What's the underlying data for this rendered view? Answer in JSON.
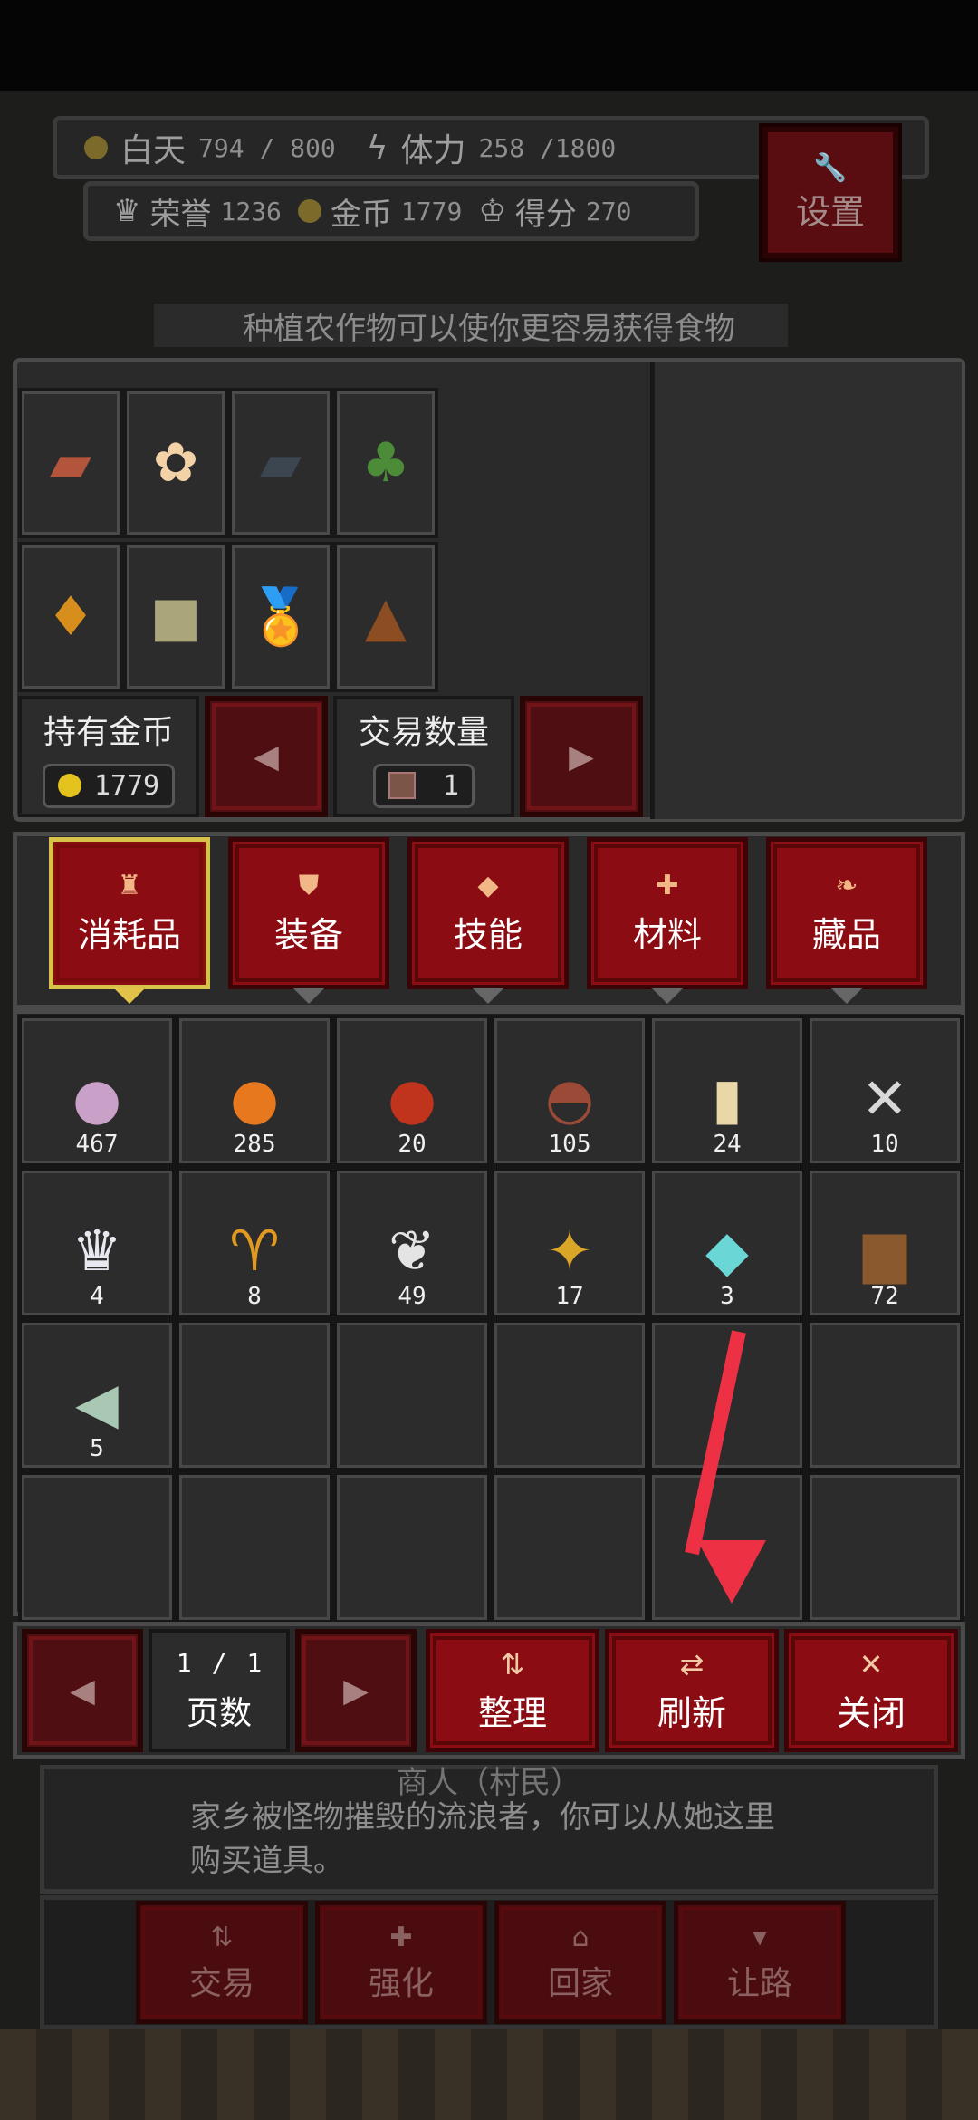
{
  "hud": {
    "day_label": "白天",
    "day_value": "794 / 800",
    "stamina_label": "体力",
    "stamina_value": "258 /1800",
    "honor_label": "荣誉",
    "honor_value": "1236",
    "gold_label": "金币",
    "gold_value": "1779",
    "score_label": "得分",
    "score_value": "270",
    "settings_label": "设置",
    "hint": "种植农作物可以使你更容易获得食物"
  },
  "trade": {
    "items": [
      {
        "icon": "brick-block-icon",
        "glyph": "▰",
        "color": "#b2553c"
      },
      {
        "icon": "flower-icon",
        "glyph": "✿",
        "color": "#f4d2a8"
      },
      {
        "icon": "stone-block-icon",
        "glyph": "▰",
        "color": "#3c4650"
      },
      {
        "icon": "tree-icon",
        "glyph": "♣",
        "color": "#4c8c38"
      },
      {
        "icon": "amber-shard-icon",
        "glyph": "♦",
        "color": "#d88e1c"
      },
      {
        "icon": "sand-block-icon",
        "glyph": "■",
        "color": "#aaa57a"
      },
      {
        "icon": "medal-icon",
        "glyph": "🏅",
        "color": "#e0a428"
      },
      {
        "icon": "dung-icon",
        "glyph": "▲",
        "color": "#8c4d22"
      }
    ],
    "gold_label": "持有金币",
    "gold_value": "1779",
    "qty_label": "交易数量",
    "qty_value": "1"
  },
  "tabs": [
    {
      "label": "消耗品",
      "icon": "potion-icon",
      "glyph": "♜",
      "selected": true
    },
    {
      "label": "装备",
      "icon": "shield-icon",
      "glyph": "⛊",
      "selected": false
    },
    {
      "label": "技能",
      "icon": "diamond-icon",
      "glyph": "◆",
      "selected": false
    },
    {
      "label": "材料",
      "icon": "material-icon",
      "glyph": "✚",
      "selected": false
    },
    {
      "label": "藏品",
      "icon": "leaf-icon",
      "glyph": "❧",
      "selected": false
    }
  ],
  "inventory": [
    {
      "icon": "turnip-icon",
      "glyph": "●",
      "color": "#c9a0c8",
      "count": "467"
    },
    {
      "icon": "pumpkin-icon",
      "glyph": "●",
      "color": "#e8781e",
      "count": "285"
    },
    {
      "icon": "berries-icon",
      "glyph": "●",
      "color": "#c0331c",
      "count": "20"
    },
    {
      "icon": "soup-bowl-icon",
      "glyph": "◓",
      "color": "#9a4a36",
      "count": "105"
    },
    {
      "icon": "jar-icon",
      "glyph": "▮",
      "color": "#e9d7a8",
      "count": "24"
    },
    {
      "icon": "bone-icon",
      "glyph": "✕",
      "color": "#d8d8d8",
      "count": "10"
    },
    {
      "icon": "crown-icon",
      "glyph": "♛",
      "color": "#e8e8f0",
      "count": "4"
    },
    {
      "icon": "goblet-icon",
      "glyph": "♈",
      "color": "#e09a22",
      "count": "8"
    },
    {
      "icon": "winged-trophy-icon",
      "glyph": "❦",
      "color": "#e4e4e4",
      "count": "49"
    },
    {
      "icon": "gold-ornament-icon",
      "glyph": "✦",
      "color": "#d9a628",
      "count": "17"
    },
    {
      "icon": "crystal-icon",
      "glyph": "◆",
      "color": "#6ad6d6",
      "count": "3"
    },
    {
      "icon": "treasure-chest-icon",
      "glyph": "▆",
      "color": "#8a5a2e",
      "count": "72"
    },
    {
      "icon": "fish-icon",
      "glyph": "◀",
      "color": "#a8c8b4",
      "count": "5"
    }
  ],
  "bottom": {
    "page_current": "1",
    "page_sep": "/",
    "page_total": "1",
    "page_label": "页数",
    "sort_label": "整理",
    "refresh_label": "刷新",
    "close_label": "关闭"
  },
  "npc": {
    "name": "商人（村民）",
    "desc": "家乡被怪物摧毁的流浪者，你可以从她这里购买道具。"
  },
  "actions": [
    {
      "label": "交易",
      "icon": "trade-icon",
      "glyph": "⇅"
    },
    {
      "label": "强化",
      "icon": "plus-icon",
      "glyph": "✚"
    },
    {
      "label": "回家",
      "icon": "home-icon",
      "glyph": "⌂"
    },
    {
      "label": "让路",
      "icon": "speech-icon",
      "glyph": "▾"
    }
  ]
}
